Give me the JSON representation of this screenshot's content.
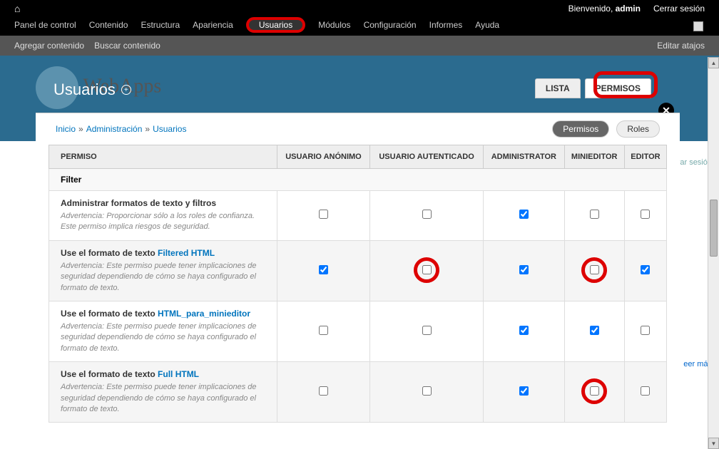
{
  "topbar": {
    "welcome_prefix": "Bienvenido, ",
    "welcome_user": "admin",
    "logout": "Cerrar sesión",
    "menu": [
      "Panel de control",
      "Contenido",
      "Estructura",
      "Apariencia",
      "Usuarios",
      "Módulos",
      "Configuración",
      "Informes",
      "Ayuda"
    ]
  },
  "secondbar": {
    "add_content": "Agregar contenido",
    "find_content": "Buscar contenido",
    "edit_shortcuts": "Editar atajos"
  },
  "background_logo": "WebApps",
  "page": {
    "title": "Usuarios",
    "tabs": {
      "lista": "LISTA",
      "permisos": "PERMISOS"
    }
  },
  "breadcrumb": {
    "home": "Inicio",
    "admin": "Administración",
    "users": "Usuarios"
  },
  "pill_tabs": {
    "permisos": "Permisos",
    "roles": "Roles"
  },
  "table": {
    "headers": {
      "permiso": "PERMISO",
      "anon": "USUARIO ANÓNIMO",
      "auth": "USUARIO AUTENTICADO",
      "admin": "ADMINISTRATOR",
      "mini": "MINIEDITOR",
      "editor": "EDITOR"
    },
    "section": "Filter",
    "rows": [
      {
        "title_prefix": "Administrar formatos de texto y filtros",
        "link": "",
        "warning": "Advertencia: Proporcionar sólo a los roles de confianza. Este permiso implica riesgos de seguridad.",
        "checks": {
          "anon": false,
          "auth": false,
          "admin": true,
          "mini": false,
          "editor": false
        },
        "circles": {}
      },
      {
        "title_prefix": "Use el formato de texto ",
        "link": "Filtered HTML",
        "warning": "Advertencia: Este permiso puede tener implicaciones de seguridad dependiendo de cómo se haya configurado el formato de texto.",
        "checks": {
          "anon": true,
          "auth": false,
          "admin": true,
          "mini": false,
          "editor": true
        },
        "circles": {
          "auth": true,
          "mini": true
        }
      },
      {
        "title_prefix": "Use el formato de texto ",
        "link": "HTML_para_minieditor",
        "warning": "Advertencia: Este permiso puede tener implicaciones de seguridad dependiendo de cómo se haya configurado el formato de texto.",
        "checks": {
          "anon": false,
          "auth": false,
          "admin": true,
          "mini": true,
          "editor": false
        },
        "circles": {}
      },
      {
        "title_prefix": "Use el formato de texto ",
        "link": "Full HTML",
        "warning": "Advertencia: Este permiso puede tener implicaciones de seguridad dependiendo de cómo se haya configurado el formato de texto.",
        "checks": {
          "anon": false,
          "auth": false,
          "admin": true,
          "mini": false,
          "editor": false
        },
        "circles": {
          "mini": true
        }
      }
    ]
  },
  "behind": {
    "logout": "rrar sesión",
    "more": "eer más"
  }
}
